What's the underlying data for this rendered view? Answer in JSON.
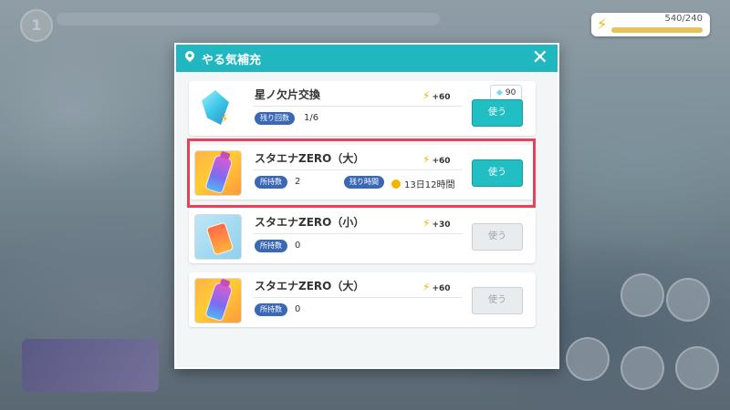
{
  "dialog": {
    "title": "やる気補充"
  },
  "stamina": {
    "value": "540/240"
  },
  "hud": {
    "level": "1"
  },
  "items": [
    {
      "name": "星ノ欠片交換",
      "gain": "+60",
      "stat1_label": "残り回数",
      "stat1_value": "1/6",
      "cost": "90",
      "button": "使う",
      "enabled": true,
      "icon": "crystal-icon"
    },
    {
      "name": "スタエナZERO（大）",
      "gain": "+60",
      "stat1_label": "所持数",
      "stat1_value": "2",
      "stat2_label": "残り時間",
      "stat2_value": "13日12時間",
      "button": "使う",
      "enabled": true,
      "highlighted": true,
      "icon": "energy-bottle-large-icon"
    },
    {
      "name": "スタエナZERO（小）",
      "gain": "+30",
      "stat1_label": "所持数",
      "stat1_value": "0",
      "button": "使う",
      "enabled": false,
      "icon": "energy-can-small-icon"
    },
    {
      "name": "スタエナZERO（大）",
      "gain": "+60",
      "stat1_label": "所持数",
      "stat1_value": "0",
      "button": "使う",
      "enabled": false,
      "icon": "energy-bottle-large-icon"
    }
  ],
  "colors": {
    "header": "#20b7c0",
    "button": "#21bfc4",
    "badge": "#3b68b5",
    "highlight": "#e8425a"
  }
}
